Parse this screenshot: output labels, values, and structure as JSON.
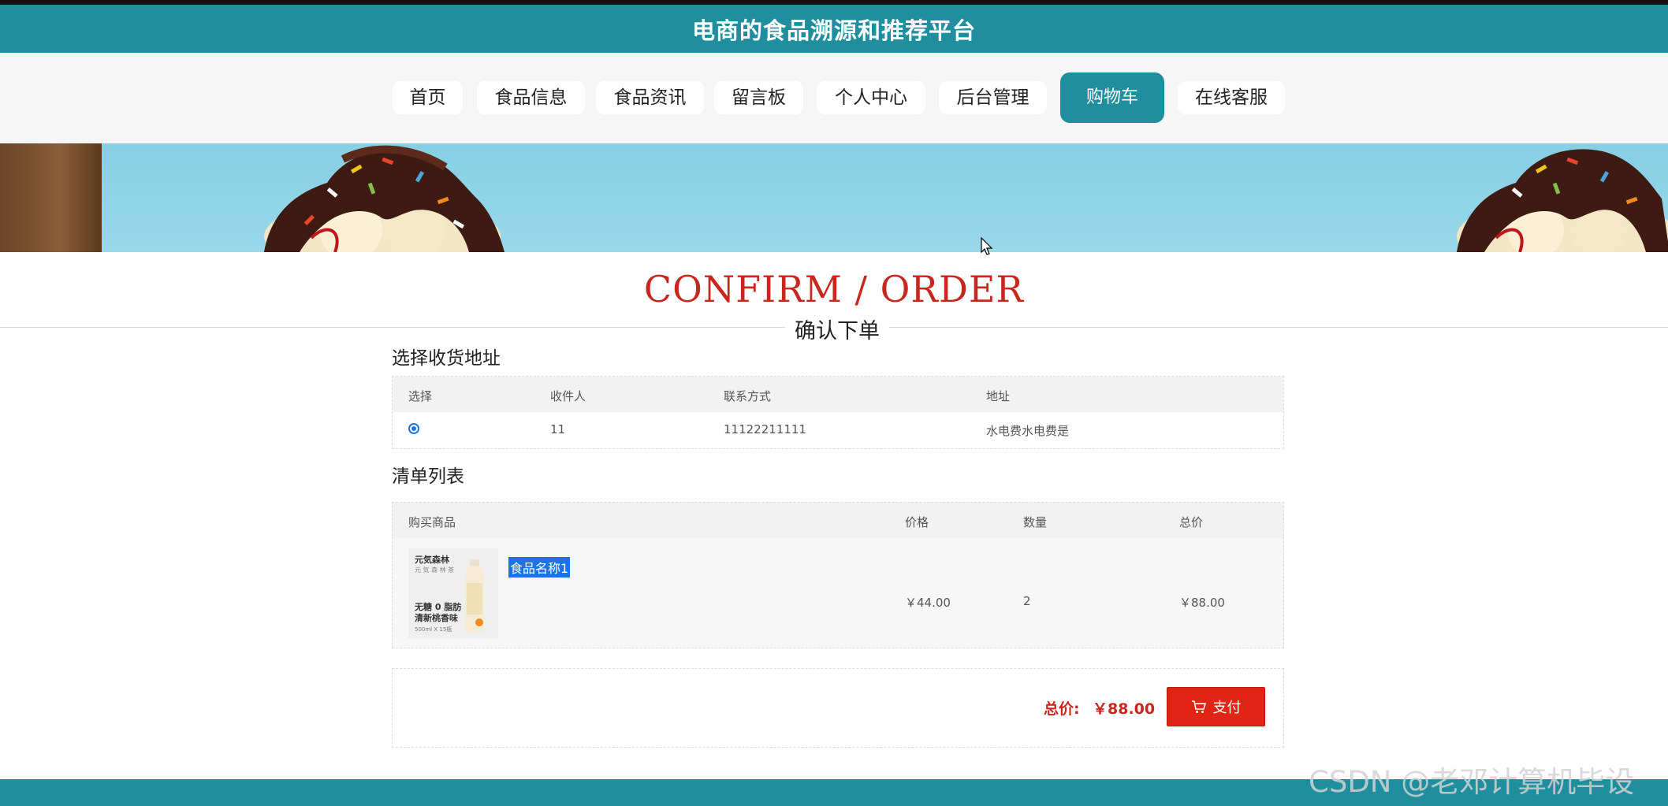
{
  "site": {
    "title": "电商的食品溯源和推荐平台"
  },
  "nav": {
    "items": [
      {
        "label": "首页"
      },
      {
        "label": "食品信息"
      },
      {
        "label": "食品资讯"
      },
      {
        "label": "留言板"
      },
      {
        "label": "个人中心"
      },
      {
        "label": "后台管理"
      },
      {
        "label": "购物车",
        "active": true
      },
      {
        "label": "在线客服"
      }
    ]
  },
  "heading": {
    "en": "CONFIRM / ORDER",
    "cn": "确认下单"
  },
  "address": {
    "title": "选择收货地址",
    "headers": [
      "选择",
      "收件人",
      "联系方式",
      "地址"
    ],
    "rows": [
      {
        "selected": true,
        "recipient": "11",
        "phone": "11122211111",
        "address": "水电费水电费是"
      }
    ]
  },
  "cart": {
    "title": "清单列表",
    "headers": [
      "购买商品",
      "价格",
      "数量",
      "总价"
    ],
    "rows": [
      {
        "name": "食品名称1",
        "price": "￥44.00",
        "quantity": "2",
        "total": "￥88.00",
        "image_text": {
          "brand": "元気森林",
          "sub": "元 気 森 林 茶",
          "line1": "无糖 0 脂肪",
          "line2": "清新桃香味",
          "line3": "500ml X 15瓶"
        }
      }
    ]
  },
  "summary": {
    "label": "总价:",
    "value": "￥88.00",
    "pay_label": "支付"
  },
  "watermark": "CSDN @老邓计算机毕设",
  "colors": {
    "brand": "#1f8f9f",
    "accent_red": "#c6281e",
    "pay_button": "#e02514",
    "selection": "#1a73e8"
  }
}
